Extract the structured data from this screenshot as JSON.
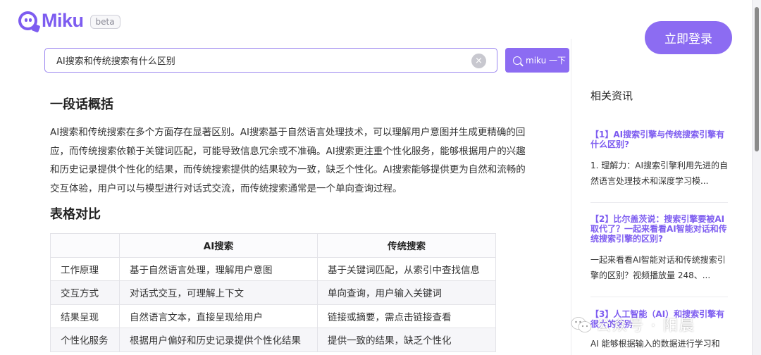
{
  "header": {
    "logo_text": "Miku",
    "beta_label": "beta",
    "login_label": "立即登录"
  },
  "search": {
    "value": "AI搜索和传统搜索有什么区别",
    "clear_glyph": "×",
    "button_label": "miku 一下"
  },
  "summary": {
    "heading": "一段话概括",
    "text": "AI搜索和传统搜索在多个方面存在显著区别。AI搜索基于自然语言处理技术，可以理解用户意图并生成更精确的回应，而传统搜索依赖于关键词匹配，可能导致信息冗余或不准确。AI搜索更注重个性化服务，能够根据用户的兴趣和历史记录提供个性化的结果，而传统搜索提供的结果较为一致，缺乏个性化。AI搜索能够提供更为自然和流畅的交互体验，用户可以与模型进行对话式交流，而传统搜索通常是一个单向查询过程。"
  },
  "comparison": {
    "heading": "表格对比",
    "columns": [
      "",
      "AI搜索",
      "传统搜索"
    ],
    "rows": [
      [
        "工作原理",
        "基于自然语言处理，理解用户意图",
        "基于关键词匹配，从索引中查找信息"
      ],
      [
        "交互方式",
        "对话式交互，可理解上下文",
        "单向查询，用户输入关键词"
      ],
      [
        "结果呈现",
        "自然语言文本，直接呈现给用户",
        "链接或摘要，需点击链接查看"
      ],
      [
        "个性化服务",
        "根据用户偏好和历史记录提供个性化结果",
        "提供一致的结果，缺乏个性化"
      ]
    ]
  },
  "news": {
    "title": "相关资讯",
    "items": [
      {
        "title": "【1】AI搜索引擎与传统搜索引擎有什么区别?",
        "desc": "1. 理解力：AI搜索引擎利用先进的自然语言处理技术和深度学习模..."
      },
      {
        "title": "【2】比尔盖茨说：搜索引擎要被AI取代了？一起来看看AI智能对话和传统搜索引擎的区别?",
        "desc": "一起来看看AI智能对话和传统搜索引擎的区别？视频播放量 248、..."
      },
      {
        "title": "【3】人工智能（AI）和搜索引擎有很大的区别",
        "desc": "AI 能够根据输入的数据进行学习和"
      }
    ]
  },
  "watermark": {
    "text": "公众号 · 阳晨"
  },
  "colors": {
    "accent": "#8c6cf2",
    "link": "#7d5cf0"
  }
}
